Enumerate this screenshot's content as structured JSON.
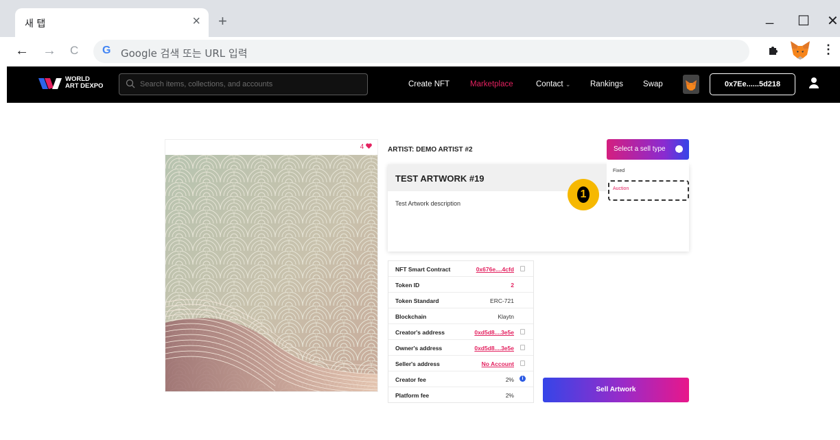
{
  "browser": {
    "tab_title": "새 탭",
    "tab_close": "×",
    "new_tab": "+",
    "minimize": "_",
    "maximize": "☐",
    "close": "✕",
    "back": "←",
    "forward": "→",
    "reload": "C",
    "google_icon": "G",
    "omnibox_placeholder": "Google 검색 또는 URL 입력",
    "menu": "⋮"
  },
  "header": {
    "logo_line1": "WORLD",
    "logo_line2": "ART DEXPO",
    "search_placeholder": "Search items, collections, and accounts",
    "nav": {
      "create": "Create NFT",
      "marketplace": "Marketplace",
      "contact": "Contact",
      "contact_chevron": "⌄",
      "rankings": "Rankings",
      "swap": "Swap"
    },
    "wallet": "0x7Ee......5d218",
    "accent_color": "#e3215f"
  },
  "artwork": {
    "likes": "4",
    "artist": "ARTIST: DEMO ARTIST #2",
    "title": "TEST ARTWORK #19",
    "description": "Test Artwork description"
  },
  "sell_type": {
    "label": "Select a sell type",
    "options": [
      "Fixed",
      "Auction"
    ],
    "callout_number": "1"
  },
  "properties": [
    {
      "label": "NFT Smart Contract",
      "value": "0x676e....4cfd"
    },
    {
      "label": "Token ID",
      "value": "2"
    },
    {
      "label": "Token Standard",
      "value": "ERC-721"
    },
    {
      "label": "Blockchain",
      "value": "Klaytn"
    },
    {
      "label": "Creator's address",
      "value": "0xd5d8....3e5e"
    },
    {
      "label": "Owner's address",
      "value": "0xd5d8....3e5e"
    },
    {
      "label": "Seller's address",
      "value": "No Account"
    },
    {
      "label": "Creator fee",
      "value": "2%"
    },
    {
      "label": "Platform fee",
      "value": "2%"
    }
  ],
  "info_icon_glyph": "i",
  "sell_button": "Sell Artwork"
}
